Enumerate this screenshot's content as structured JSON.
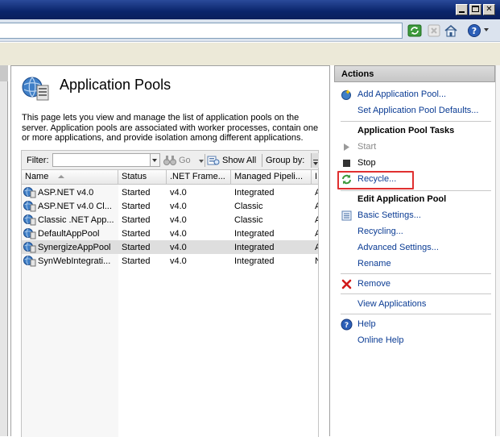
{
  "window": {
    "buttons": [
      "minimize",
      "maximize",
      "close"
    ],
    "close_glyph": "✕"
  },
  "toolbar": {
    "icons": [
      "refresh-icon",
      "stop-icon",
      "home-icon",
      "help-icon"
    ]
  },
  "page": {
    "title": "Application Pools",
    "description": "This page lets you view and manage the list of application pools on the server. Application pools are associated with worker processes, contain one or more applications, and provide isolation among different applications."
  },
  "filter": {
    "label": "Filter:",
    "value": "",
    "go_label": "Go",
    "show_all_label": "Show All",
    "group_by_label": "Group by:"
  },
  "list": {
    "columns": [
      {
        "label": "Name"
      },
      {
        "label": "Status"
      },
      {
        "label": ".NET Frame..."
      },
      {
        "label": "Managed Pipeli..."
      },
      {
        "label": "I"
      }
    ],
    "rows": [
      {
        "name": "ASP.NET v4.0",
        "status": "Started",
        "framework": "v4.0",
        "pipeline": "Integrated",
        "identity": "A",
        "selected": false
      },
      {
        "name": "ASP.NET v4.0 Cl...",
        "status": "Started",
        "framework": "v4.0",
        "pipeline": "Classic",
        "identity": "A",
        "selected": false
      },
      {
        "name": "Classic .NET App...",
        "status": "Started",
        "framework": "v4.0",
        "pipeline": "Classic",
        "identity": "A",
        "selected": false
      },
      {
        "name": "DefaultAppPool",
        "status": "Started",
        "framework": "v4.0",
        "pipeline": "Integrated",
        "identity": "A",
        "selected": false
      },
      {
        "name": "SynergizeAppPool",
        "status": "Started",
        "framework": "v4.0",
        "pipeline": "Integrated",
        "identity": "A",
        "selected": true
      },
      {
        "name": "SynWebIntegrati...",
        "status": "Started",
        "framework": "v4.0",
        "pipeline": "Integrated",
        "identity": "N",
        "selected": false
      }
    ]
  },
  "actions": {
    "header": "Actions",
    "add_pool": "Add Application Pool...",
    "set_defaults": "Set Application Pool Defaults...",
    "tasks_heading": "Application Pool Tasks",
    "start": "Start",
    "stop": "Stop",
    "recycle": "Recycle...",
    "edit_heading": "Edit Application Pool",
    "basic_settings": "Basic Settings...",
    "recycling": "Recycling...",
    "advanced_settings": "Advanced Settings...",
    "rename": "Rename",
    "remove": "Remove",
    "view_applications": "View Applications",
    "help": "Help",
    "online_help": "Online Help"
  },
  "colors": {
    "titlebar": "#0a246a",
    "link": "#0b3c94",
    "highlight": "#e03030",
    "selected_row": "#dedede"
  }
}
